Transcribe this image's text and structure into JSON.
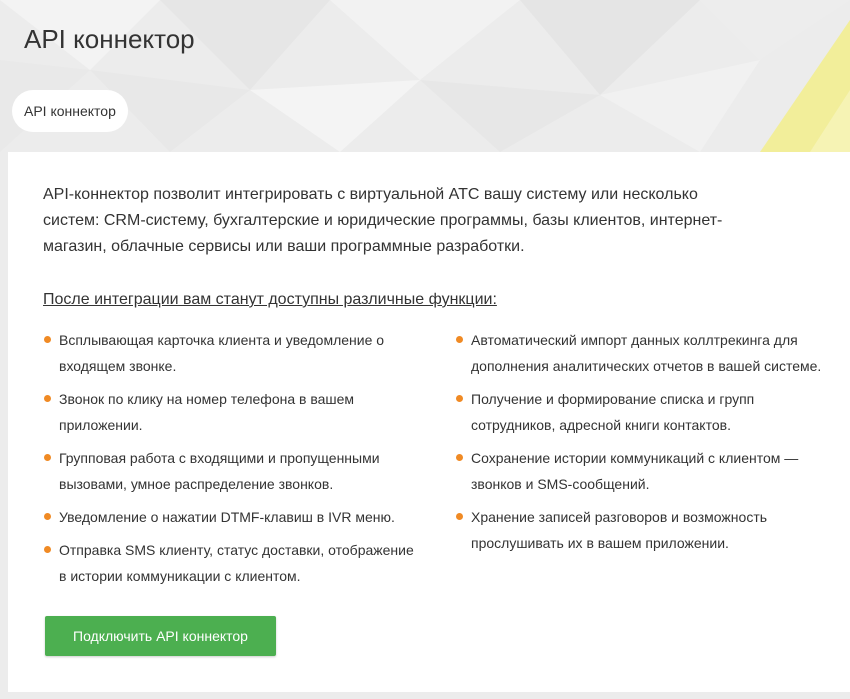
{
  "header": {
    "title": "API коннектор"
  },
  "breadcrumb": {
    "label": "API коннектор"
  },
  "content": {
    "intro": "API-коннектор позволит интегрировать с виртуальной АТС вашу систему или несколько систем: CRM-систему, бухгалтерские и юридические программы, базы клиентов, интернет-магазин, облачные сервисы или ваши программные разработки.",
    "features_heading": "После интеграции вам станут доступны различные функции:",
    "features_left": [
      "Всплывающая карточка клиента и уведомление о входящем звонке.",
      "Звонок по клику на номер телефона в вашем приложении.",
      "Групповая работа с входящими и пропущенными вызовами, умное распределение звонков.",
      "Уведомление о нажатии DTMF-клавиш в IVR меню.",
      "Отправка SMS клиенту, статус доставки, отображение в истории коммуникации с клиентом."
    ],
    "features_right": [
      "Автоматический импорт данных коллтрекинга для дополнения аналитических отчетов в вашей системе.",
      "Получение и формирование списка и групп сотрудников, адресной книги контактов.",
      "Сохранение истории коммуникаций с клиентом — звонков и SMS-сообщений.",
      "Хранение записей разговоров и возможность прослушивать их в вашем приложении."
    ],
    "connect_button": "Подключить API коннектор"
  },
  "colors": {
    "accent_green": "#4caf50",
    "bullet_orange": "#f08a24",
    "decor_yellow": "#f2ee9a"
  }
}
